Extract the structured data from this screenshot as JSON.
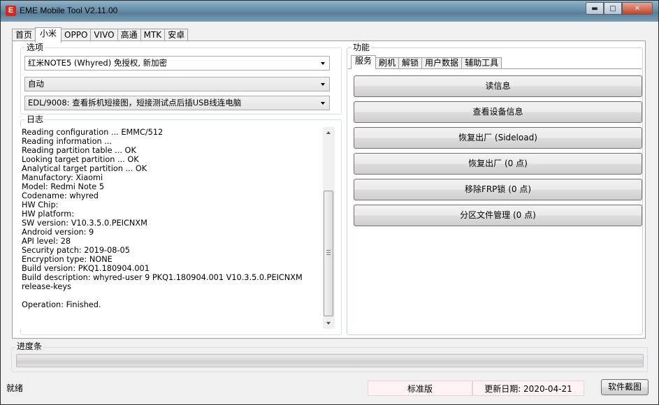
{
  "window": {
    "title": "EME Mobile Tool V2.11.00",
    "logo_letter": "E",
    "min_glyph": "▬",
    "max_glyph": "□",
    "close_glyph": "✕"
  },
  "top_tabs": [
    "首页",
    "小米",
    "OPPO",
    "VIVO",
    "高通",
    "MTK",
    "安卓"
  ],
  "active_top_tab": 1,
  "options": {
    "title": "选项",
    "combo_device": "红米NOTE5 (Whyred) 免授权, 新加密",
    "combo_mode": "自动",
    "combo_method": "EDL/9008: 查看拆机短接图，短接测试点后插USB线连电脑"
  },
  "log": {
    "title": "日志",
    "lines": "Reading configuration ... EMMC/512\nReading information ...\nReading partition table ... OK\nLooking target partition ... OK\nAnalytical target partition ... OK\nManufactory: Xiaomi\nModel: Redmi Note 5\nCodename: whyred\nHW Chip:\nHW platform:\nSW version: V10.3.5.0.PEICNXM\nAndroid version: 9\nAPI level: 28\nSecurity patch: 2019-08-05\nEncryption type: NONE\nBuild version: PKQ1.180904.001\nBuild description: whyred-user 9 PKQ1.180904.001 V10.3.5.0.PEICNXM release-keys\n\nOperation: Finished."
  },
  "functions": {
    "title": "功能",
    "tabs": [
      "服务",
      "刷机",
      "解锁",
      "用户数据",
      "辅助工具"
    ],
    "active_tab": 0,
    "buttons": [
      "读信息",
      "查看设备信息",
      "恢复出厂 (Sideload)",
      "恢复出厂 (0 点)",
      "移除FRP锁 (0 点)",
      "分区文件管理 (0 点)"
    ]
  },
  "progress": {
    "title": "进度条",
    "value": 0
  },
  "status": {
    "ready": "就绪",
    "edition": "标准版",
    "update_date": "更新日期: 2020-04-21",
    "screenshot_button": "软件截图"
  },
  "colors": {
    "progress_fill": "#06b025",
    "logo_red": "#d9261c"
  }
}
